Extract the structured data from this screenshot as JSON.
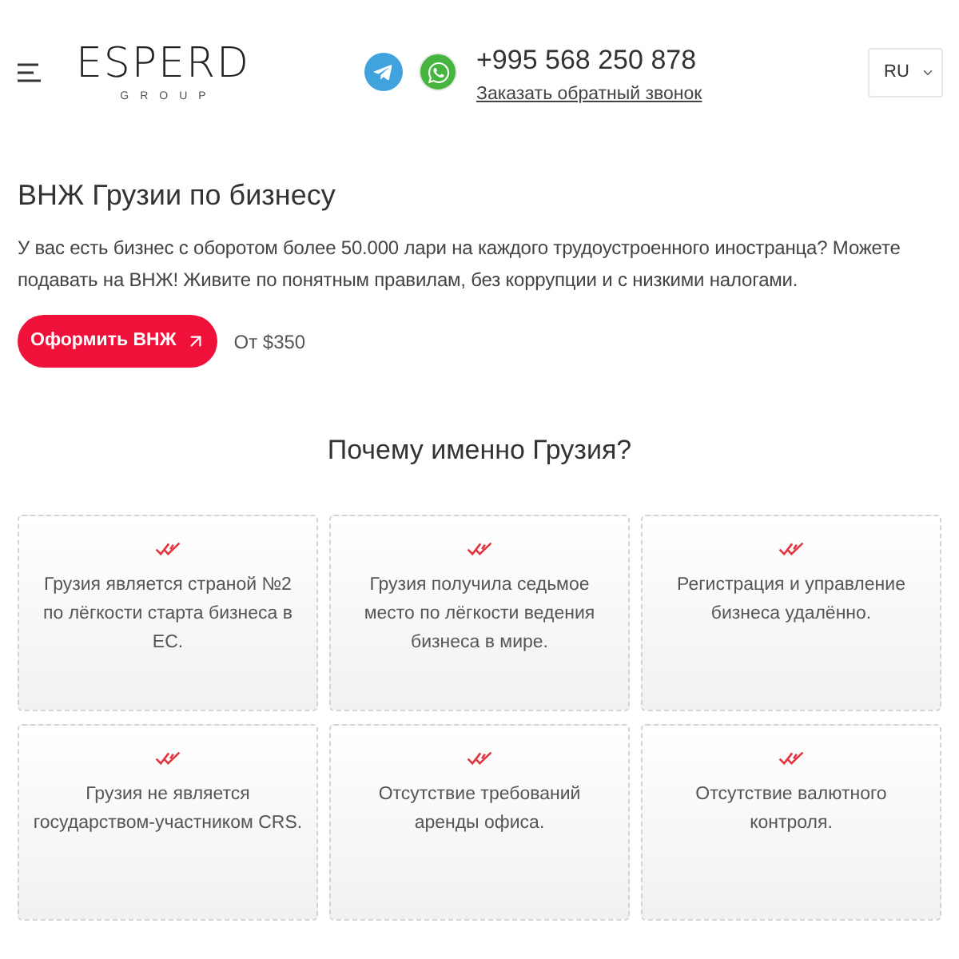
{
  "header": {
    "brand": "ESPERD",
    "brand_tagline": "GROUP",
    "phone": "+995 568 250 878",
    "callback_link": "Заказать обратный звонок",
    "language": "RU"
  },
  "hero": {
    "title": "ВНЖ Грузии по бизнесу",
    "text": "У вас есть бизнес с оборотом более 50.000 лари на каждого трудоустроенного иностранца? Можете подавать на ВНЖ! Живите по понятным правилам, без коррупции и с низкими налогами.",
    "button": "Оформить ВНЖ",
    "price": "От $350"
  },
  "why": {
    "title": "Почему именно Грузия?",
    "cards": [
      {
        "lines": [
          "Грузия является страной №2",
          "по лёгкости старта бизнеса в",
          "ЕС."
        ]
      },
      {
        "lines": [
          "Грузия получила седьмое",
          "место по лёгкости ведения",
          "бизнеса в мире."
        ]
      },
      {
        "lines": [
          "Регистрация и управление",
          "бизнеса удалённо."
        ]
      },
      {
        "lines": [
          "Грузия не является",
          "государством-участником CRS."
        ]
      },
      {
        "lines": [
          "Отсутствие требований",
          "аренды офиса."
        ]
      },
      {
        "lines": [
          "Отсутствие валютного",
          "контроля."
        ]
      }
    ]
  }
}
